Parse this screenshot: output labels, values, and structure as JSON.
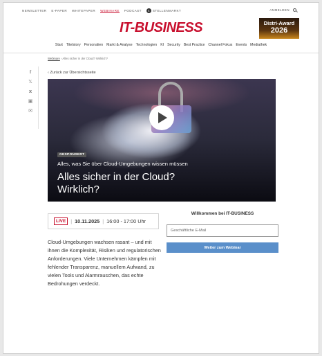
{
  "topbar": {
    "links": [
      "NEWSLETTER",
      "E-PAPER",
      "WHITEPAPER",
      "WEBINARE",
      "PODCAST",
      "STELLENMARKT"
    ],
    "active_link": "WEBINARE",
    "stellenmarkt_badge": "S",
    "login": "ANMELDEN"
  },
  "logo": "IT-BUSINESS",
  "award": {
    "line1": "Distri-Award",
    "line2": "2026"
  },
  "nav": [
    "Start",
    "Titelstory",
    "Personalien",
    "Markt & Analyse",
    "Technologien",
    "KI",
    "Security",
    "Best Practice",
    "Channel Fokus",
    "Events",
    "Mediathek"
  ],
  "breadcrumb": {
    "link": "Webinare",
    "separator": " › ",
    "current": "Alles sicher in der Cloud? Wirklich?"
  },
  "back_link": "‹ Zurück zur Übersichtsseite",
  "hero": {
    "badge": "GESPONSERT",
    "subtitle": "Alles, was Sie über Cloud-Umgebungen wissen müssen",
    "title": "Alles sicher in der Cloud? Wirklich?"
  },
  "event": {
    "live": "LIVE",
    "date": "10.11.2025",
    "time": "16:00 - 17:00 Uhr",
    "sep": "|"
  },
  "body": "Cloud-Umgebungen wachsen rasant – und mit ihnen die Komplexität, Risiken und regulatorischen Anforderungen. Viele Unternehmen kämpfen mit fehlender Transparenz, manuellem Aufwand, zu vielen Tools und Alarmrauschen, das echte Bedrohungen verdeckt.",
  "form": {
    "title": "Willkommen bei IT-BUSINESS",
    "email_placeholder": "Geschäftliche E-Mail",
    "email_value": "",
    "submit": "Weiter zum Webinar"
  },
  "colors": {
    "brand": "#c8102e",
    "button": "#5a8fca"
  }
}
